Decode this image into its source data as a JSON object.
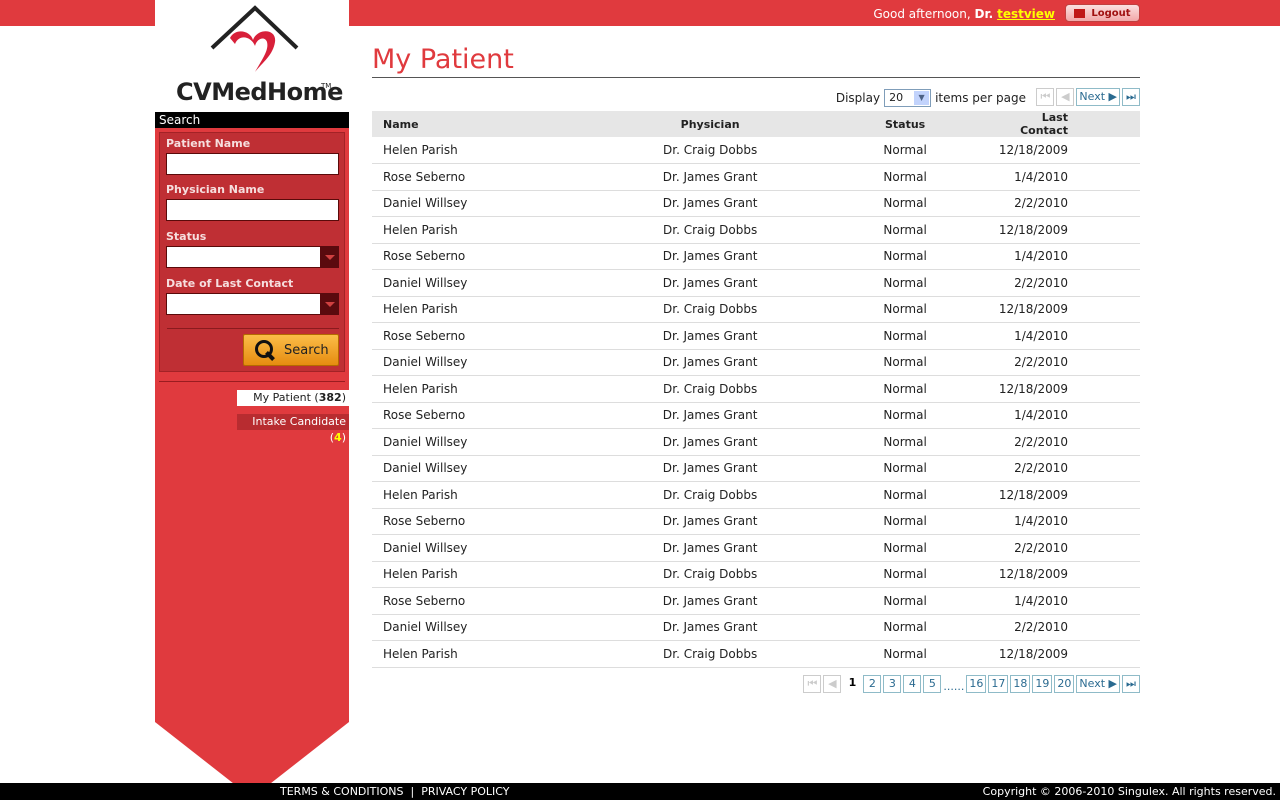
{
  "header": {
    "greeting": "Good afternoon,",
    "title_prefix": "Dr.",
    "username": "testview",
    "logout_label": "Logout"
  },
  "logo": {
    "text": "CVMedHome",
    "tm": "TM"
  },
  "search": {
    "heading": "Search",
    "patient_label": "Patient Name",
    "patient_value": "",
    "physician_label": "Physician Name",
    "physician_value": "",
    "status_label": "Status",
    "status_value": "",
    "date_label": "Date of Last Contact",
    "date_value": "",
    "button": "Search"
  },
  "nav": [
    {
      "label": "My Patient",
      "count": "382",
      "active": true
    },
    {
      "label": "Intake Candidate",
      "count": "4",
      "active": false
    }
  ],
  "main": {
    "title": "My Patient",
    "display_label": "Display",
    "items_per_page": "20",
    "items_suffix": "items per page",
    "next_label": "Next"
  },
  "table": {
    "columns": [
      "Name",
      "Physician",
      "Status",
      "Last Contact"
    ],
    "rows": [
      [
        "Helen Parish",
        "Dr. Craig Dobbs",
        "Normal",
        "12/18/2009"
      ],
      [
        "Rose Seberno",
        "Dr. James Grant",
        "Normal",
        "1/4/2010"
      ],
      [
        "Daniel Willsey",
        "Dr. James Grant",
        "Normal",
        "2/2/2010"
      ],
      [
        "Helen Parish",
        "Dr. Craig Dobbs",
        "Normal",
        "12/18/2009"
      ],
      [
        "Rose Seberno",
        "Dr. James Grant",
        "Normal",
        "1/4/2010"
      ],
      [
        "Daniel Willsey",
        "Dr. James Grant",
        "Normal",
        "2/2/2010"
      ],
      [
        "Helen Parish",
        "Dr. Craig Dobbs",
        "Normal",
        "12/18/2009"
      ],
      [
        "Rose Seberno",
        "Dr. James Grant",
        "Normal",
        "1/4/2010"
      ],
      [
        "Daniel Willsey",
        "Dr. James Grant",
        "Normal",
        "2/2/2010"
      ],
      [
        "Helen Parish",
        "Dr. Craig Dobbs",
        "Normal",
        "12/18/2009"
      ],
      [
        "Rose Seberno",
        "Dr. James Grant",
        "Normal",
        "1/4/2010"
      ],
      [
        "Daniel Willsey",
        "Dr. James Grant",
        "Normal",
        "2/2/2010"
      ],
      [
        "Daniel Willsey",
        "Dr. James Grant",
        "Normal",
        "2/2/2010"
      ],
      [
        "Helen Parish",
        "Dr. Craig Dobbs",
        "Normal",
        "12/18/2009"
      ],
      [
        "Rose Seberno",
        "Dr. James Grant",
        "Normal",
        "1/4/2010"
      ],
      [
        "Daniel Willsey",
        "Dr. James Grant",
        "Normal",
        "2/2/2010"
      ],
      [
        "Helen Parish",
        "Dr. Craig Dobbs",
        "Normal",
        "12/18/2009"
      ],
      [
        "Rose Seberno",
        "Dr. James Grant",
        "Normal",
        "1/4/2010"
      ],
      [
        "Daniel Willsey",
        "Dr. James Grant",
        "Normal",
        "2/2/2010"
      ],
      [
        "Helen Parish",
        "Dr. Craig Dobbs",
        "Normal",
        "12/18/2009"
      ]
    ]
  },
  "pagination": {
    "current": "1",
    "pages_before": [
      "2",
      "3",
      "4",
      "5"
    ],
    "ellipsis": "......",
    "pages_after": [
      "16",
      "17",
      "18",
      "19",
      "20"
    ],
    "next_label": "Next"
  },
  "footer": {
    "terms": "TERMS & CONDITIONS",
    "separator": "|",
    "privacy": "PRIVACY POLICY",
    "copyright": "Copyright © 2006-2010 Singulex. All rights reserved."
  },
  "colors": {
    "brand_red": "#e03a3e",
    "dark_red": "#bf2f34",
    "button_orange": "#f0a020",
    "link_yellow": "#ffff00"
  }
}
